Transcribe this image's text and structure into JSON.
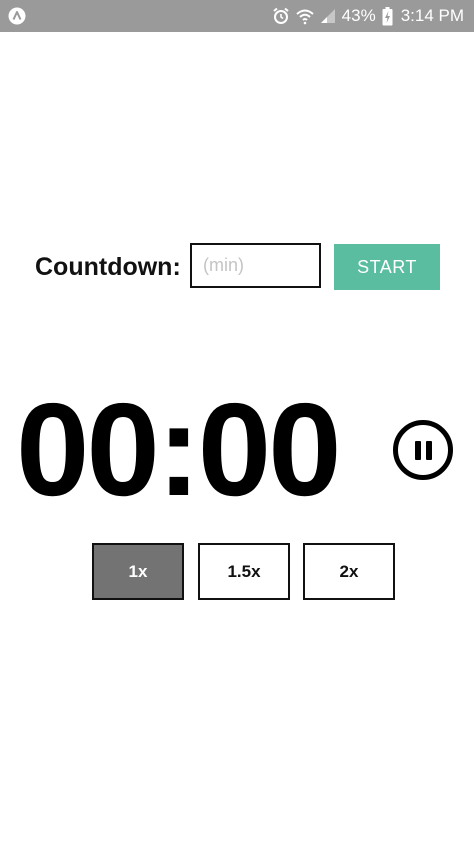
{
  "status_bar": {
    "battery_percent": "43%",
    "time": "3:14 PM",
    "icons": [
      "app-logo-icon",
      "alarm-icon",
      "wifi-icon",
      "signal-icon",
      "battery-charging-icon"
    ]
  },
  "countdown": {
    "label": "Countdown:",
    "input_placeholder": "(min)",
    "input_value": "",
    "start_label": "START"
  },
  "timer": {
    "display": "00:00",
    "state": "running"
  },
  "speed": {
    "options": [
      {
        "label": "1x",
        "selected": true
      },
      {
        "label": "1.5x",
        "selected": false
      },
      {
        "label": "2x",
        "selected": false
      }
    ]
  },
  "colors": {
    "status_bar": "#9a9a9a",
    "accent": "#5bbd9f",
    "selected_speed": "#737373",
    "text": "#111111"
  }
}
